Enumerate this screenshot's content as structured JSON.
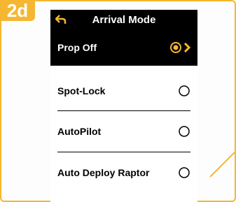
{
  "step_label": "2d",
  "header": {
    "title": "Arrival Mode",
    "back_icon": "back-arrow-icon"
  },
  "menu": {
    "items": [
      {
        "label": "Prop Off",
        "selected": true
      },
      {
        "label": "Spot-Lock",
        "selected": false
      },
      {
        "label": "AutoPilot",
        "selected": false
      },
      {
        "label": "Auto Deploy Raptor",
        "selected": false
      }
    ]
  },
  "colors": {
    "accent": "#f5b731",
    "selected_bg": "#000000",
    "radio_selected": "#f5b731"
  }
}
